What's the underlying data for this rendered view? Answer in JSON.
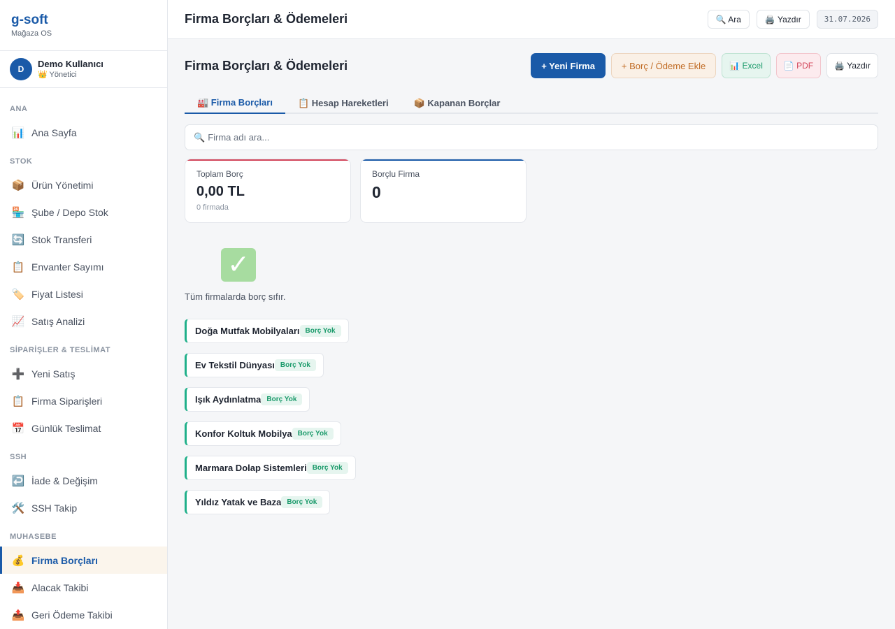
{
  "brand": {
    "name": "g-soft",
    "subtitle": "Mağaza OS"
  },
  "user": {
    "initial": "D",
    "name": "Demo Kullanıcı",
    "role": "👑 Yönetici"
  },
  "sidebar": {
    "sections": [
      {
        "title": "ANA",
        "items": [
          {
            "icon": "📊",
            "label": "Ana Sayfa"
          }
        ]
      },
      {
        "title": "STOK",
        "items": [
          {
            "icon": "📦",
            "label": "Ürün Yönetimi"
          },
          {
            "icon": "🏪",
            "label": "Şube / Depo Stok"
          },
          {
            "icon": "🔄",
            "label": "Stok Transferi"
          },
          {
            "icon": "📋",
            "label": "Envanter Sayımı"
          },
          {
            "icon": "🏷️",
            "label": "Fiyat Listesi"
          },
          {
            "icon": "📈",
            "label": "Satış Analizi"
          }
        ]
      },
      {
        "title": "SİPARİŞLER & TESLİMAT",
        "items": [
          {
            "icon": "➕",
            "label": "Yeni Satış"
          },
          {
            "icon": "📋",
            "label": "Firma Siparişleri"
          },
          {
            "icon": "📅",
            "label": "Günlük Teslimat"
          }
        ]
      },
      {
        "title": "SSH",
        "items": [
          {
            "icon": "↩️",
            "label": "İade & Değişim"
          },
          {
            "icon": "🛠️",
            "label": "SSH Takip"
          }
        ]
      },
      {
        "title": "MUHASEBE",
        "items": [
          {
            "icon": "💰",
            "label": "Firma Borçları"
          },
          {
            "icon": "📥",
            "label": "Alacak Takibi"
          },
          {
            "icon": "📤",
            "label": "Geri Ödeme Takibi"
          }
        ]
      }
    ]
  },
  "topbar": {
    "title": "Firma Borçları & Ödemeleri",
    "search_label": "🔍 Ara",
    "print_label": "🖨️ Yazdır",
    "date": "31.07.2026"
  },
  "page": {
    "title": "Firma Borçları & Ödemeleri",
    "buttons": {
      "new_firm": "+ Yeni Firma",
      "add_debt": "+ Borç / Ödeme Ekle",
      "excel": "📊 Excel",
      "pdf": "📄 PDF",
      "print": "🖨️ Yazdır"
    },
    "tabs": [
      {
        "label": "🏭 Firma Borçları"
      },
      {
        "label": "📋 Hesap Hareketleri"
      },
      {
        "label": "📦 Kapanan Borçlar"
      }
    ],
    "search": {
      "icon": "🔍",
      "placeholder": "Firma adı ara..."
    },
    "stats": {
      "total": {
        "label": "Toplam Borç",
        "value": "0,00 TL",
        "sub": "0 firmada"
      },
      "count": {
        "label": "Borçlu Firma",
        "value": "0"
      }
    },
    "empty": {
      "icon": "✓",
      "text": "Tüm firmalarda borç sıfır."
    },
    "firms": [
      {
        "name": "Doğa Mutfak Mobilyaları",
        "badge": "Borç Yok"
      },
      {
        "name": "Ev Tekstil Dünyası",
        "badge": "Borç Yok"
      },
      {
        "name": "Işık Aydınlatma",
        "badge": "Borç Yok"
      },
      {
        "name": "Konfor Koltuk Mobilya",
        "badge": "Borç Yok"
      },
      {
        "name": "Marmara Dolap Sistemleri",
        "badge": "Borç Yok"
      },
      {
        "name": "Yıldız Yatak ve Baza",
        "badge": "Borç Yok"
      }
    ]
  },
  "colors": {
    "accent": "#1a5aa8",
    "success": "#20b08a",
    "danger": "#d2455a",
    "warning": "#c06a23"
  }
}
